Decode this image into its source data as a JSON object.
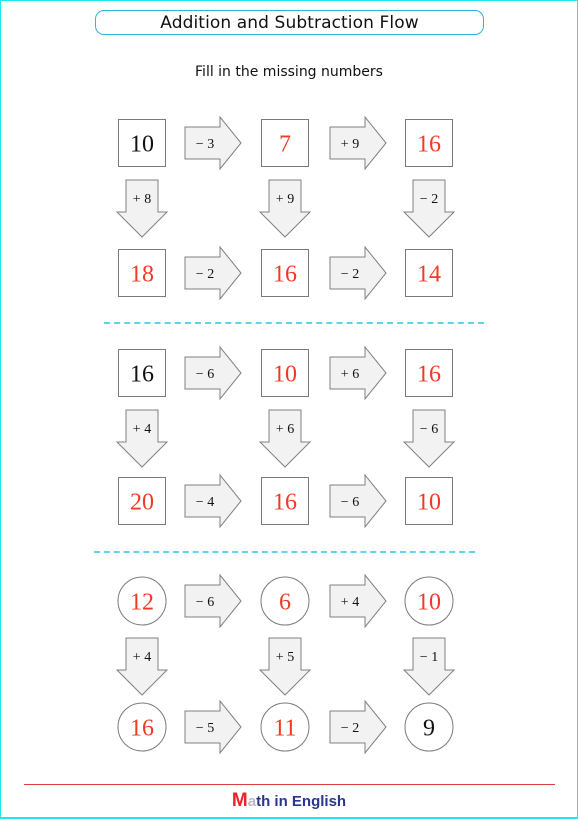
{
  "title": "Addition and Subtraction Flow",
  "subtitle": "Fill in the missing numbers",
  "colors": {
    "given": "#111111",
    "answer": "#ef3b24",
    "frame": "#1de8ec",
    "title_border": "#2fb6dc",
    "divider": "#5fd2ec",
    "arrow_fill": "#f2f2f2",
    "arrow_stroke": "#808080",
    "footer_line": "#e03a3a",
    "brand_m": "#e8262a",
    "brand_text": "#2a3590"
  },
  "puzzles": [
    {
      "shape": "square",
      "cells": [
        {
          "value": "10",
          "given": true
        },
        {
          "value": "7",
          "given": false
        },
        {
          "value": "16",
          "given": false
        },
        {
          "value": "18",
          "given": false
        },
        {
          "value": "16",
          "given": false
        },
        {
          "value": "14",
          "given": false
        }
      ],
      "top_ops": [
        "− 3",
        "+ 9"
      ],
      "down_ops": [
        "+ 8",
        "+ 9",
        "− 2"
      ],
      "bottom_ops": [
        "− 2",
        "− 2"
      ]
    },
    {
      "shape": "square",
      "cells": [
        {
          "value": "16",
          "given": true
        },
        {
          "value": "10",
          "given": false
        },
        {
          "value": "16",
          "given": false
        },
        {
          "value": "20",
          "given": false
        },
        {
          "value": "16",
          "given": false
        },
        {
          "value": "10",
          "given": false
        }
      ],
      "top_ops": [
        "− 6",
        "+ 6"
      ],
      "down_ops": [
        "+ 4",
        "+ 6",
        "− 6"
      ],
      "bottom_ops": [
        "− 4",
        "− 6"
      ]
    },
    {
      "shape": "circle",
      "cells": [
        {
          "value": "12",
          "given": false
        },
        {
          "value": "6",
          "given": false
        },
        {
          "value": "10",
          "given": false
        },
        {
          "value": "16",
          "given": false
        },
        {
          "value": "11",
          "given": false
        },
        {
          "value": "9",
          "given": true
        }
      ],
      "top_ops": [
        "− 6",
        "+ 4"
      ],
      "down_ops": [
        "+ 4",
        "+ 5",
        "− 1"
      ],
      "bottom_ops": [
        "− 5",
        "− 2"
      ]
    }
  ],
  "footer": {
    "brand_first_letter": "M",
    "brand_second_letter": "a",
    "brand_rest": "th in English"
  }
}
